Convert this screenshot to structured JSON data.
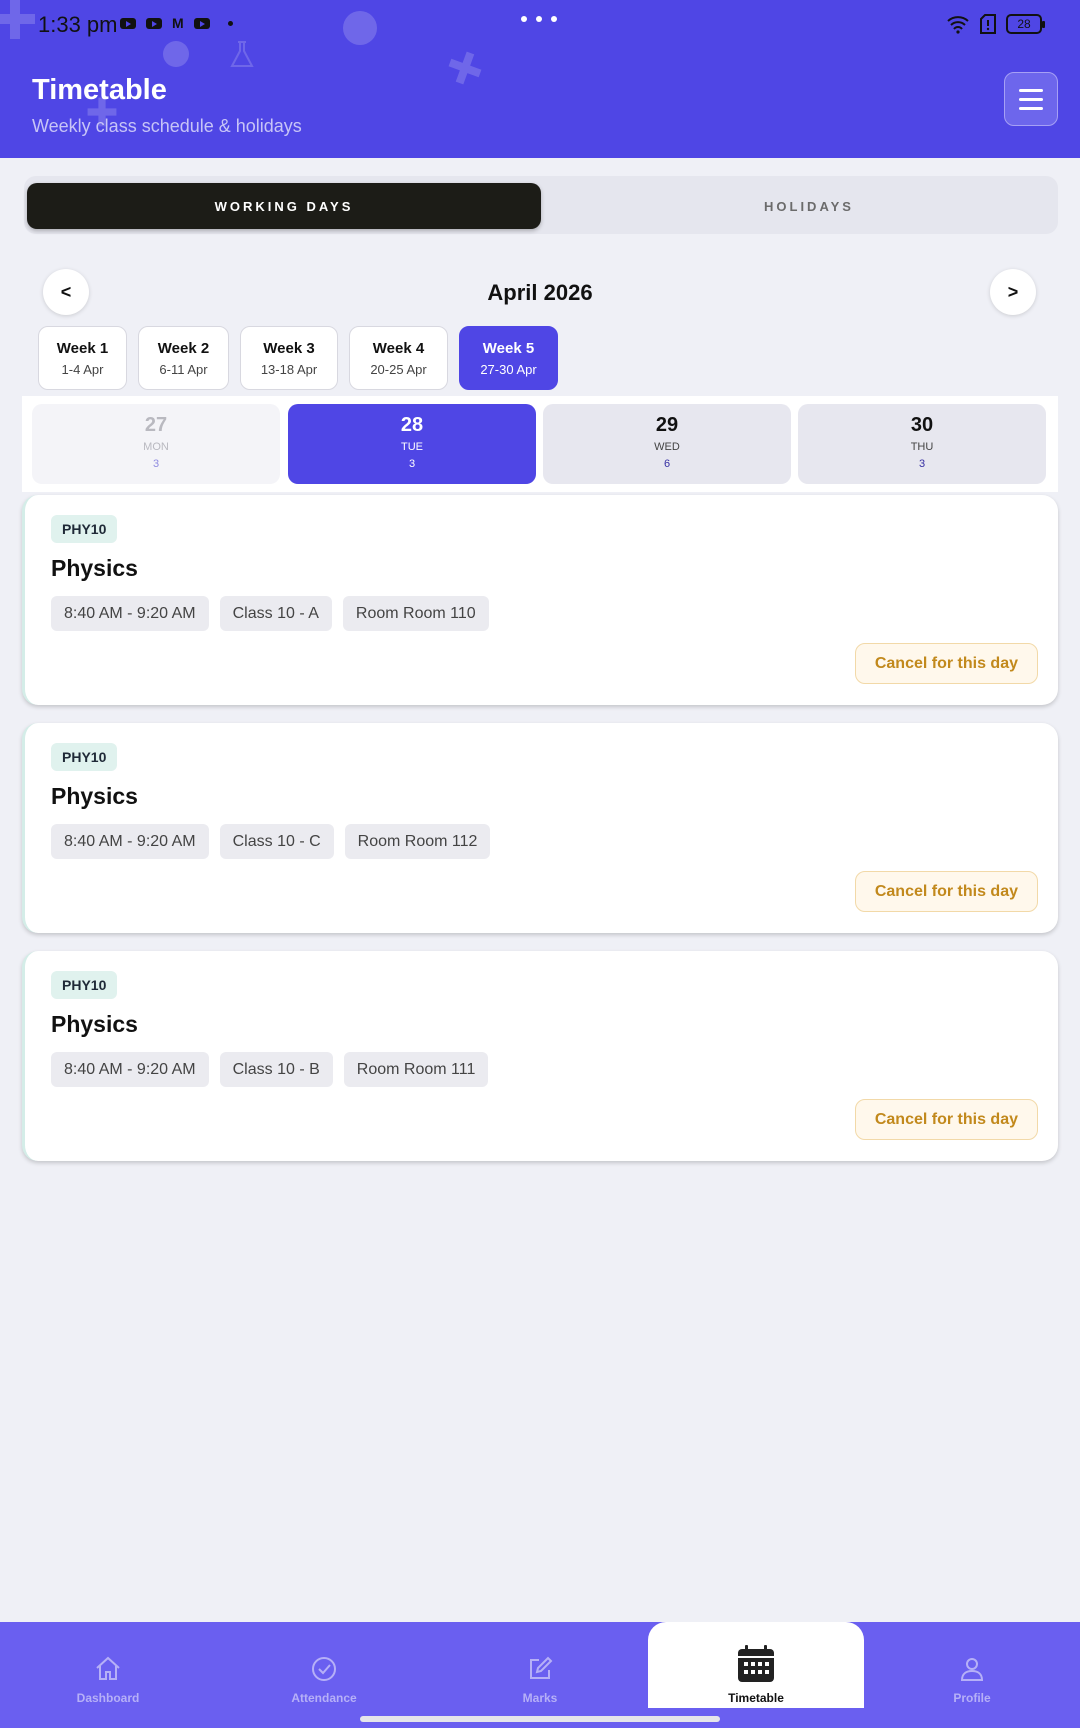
{
  "status_bar": {
    "time": "1:33 pm",
    "battery": "28"
  },
  "header": {
    "title": "Timetable",
    "subtitle": "Weekly class schedule & holidays"
  },
  "segments": {
    "working": "WORKING DAYS",
    "holidays": "HOLIDAYS"
  },
  "month_nav": {
    "prev": "<",
    "label": "April 2026",
    "next": ">"
  },
  "weeks": [
    {
      "name": "Week 1",
      "range": "1-4 Apr"
    },
    {
      "name": "Week 2",
      "range": "6-11 Apr"
    },
    {
      "name": "Week 3",
      "range": "13-18 Apr"
    },
    {
      "name": "Week 4",
      "range": "20-25 Apr"
    },
    {
      "name": "Week 5",
      "range": "27-30 Apr"
    }
  ],
  "selected_week": "Week 5",
  "days": [
    {
      "num": "27",
      "weekday": "MON",
      "count": "3"
    },
    {
      "num": "28",
      "weekday": "TUE",
      "count": "3"
    },
    {
      "num": "29",
      "weekday": "WED",
      "count": "6"
    },
    {
      "num": "30",
      "weekday": "THU",
      "count": "3"
    }
  ],
  "selected_day": "28",
  "classes": [
    {
      "code": "PHY10",
      "subject": "Physics",
      "time": "8:40 AM - 9:20 AM",
      "class": "Class 10 - A",
      "room": "Room Room 110",
      "action": "Cancel for this day"
    },
    {
      "code": "PHY10",
      "subject": "Physics",
      "time": "8:40 AM - 9:20 AM",
      "class": "Class 10 - C",
      "room": "Room Room 112",
      "action": "Cancel for this day"
    },
    {
      "code": "PHY10",
      "subject": "Physics",
      "time": "8:40 AM - 9:20 AM",
      "class": "Class 10 - B",
      "room": "Room Room 111",
      "action": "Cancel for this day"
    }
  ],
  "bottom_nav": [
    {
      "label": "Dashboard",
      "icon": "home-icon"
    },
    {
      "label": "Attendance",
      "icon": "check-circle-icon"
    },
    {
      "label": "Marks",
      "icon": "edit-icon"
    },
    {
      "label": "Timetable",
      "icon": "calendar-icon"
    },
    {
      "label": "Profile",
      "icon": "user-icon"
    }
  ],
  "active_tab": "Timetable",
  "colors": {
    "primary": "#4f46e5",
    "dark": "#1c1c17",
    "cancel": "#c2891c",
    "nav": "#6a5ff0"
  }
}
